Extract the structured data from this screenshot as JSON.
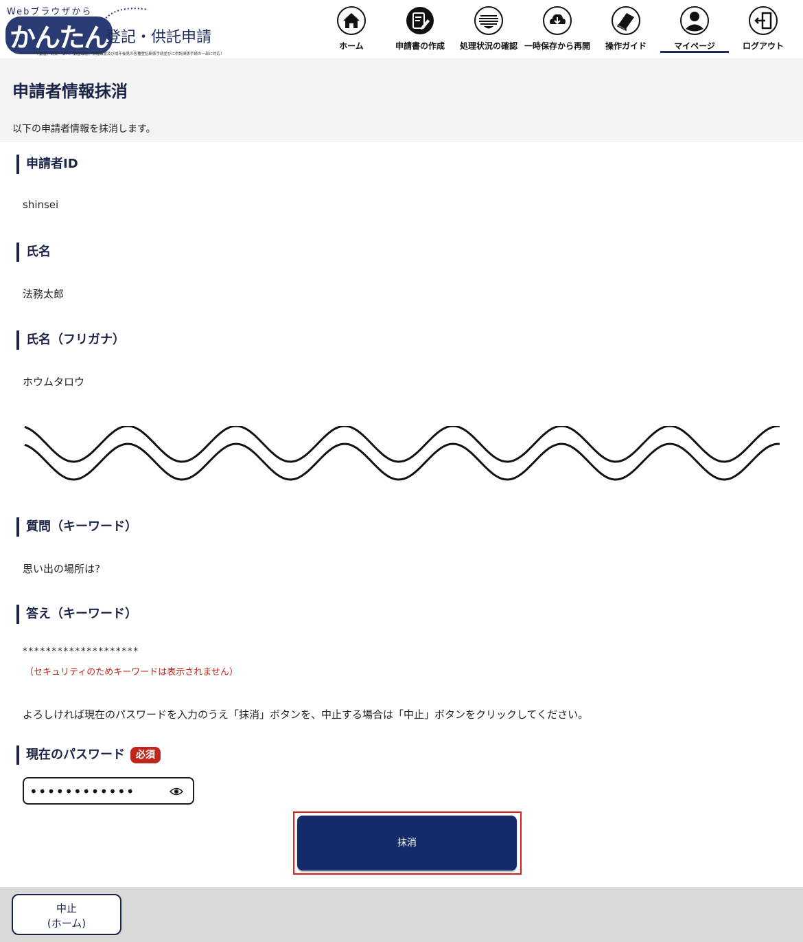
{
  "header": {
    "logo_top": "Webブラウザから",
    "logo_main": "かんたん",
    "logo_sub": "登記・供託申請",
    "logo_note": "「不動産、商業・法人、動産譲渡、債権譲渡及び成年後見の各種登記関係手続並びに供託関係手続の一部に対応！"
  },
  "nav": {
    "items": [
      {
        "label": "ホーム",
        "icon": "home-icon"
      },
      {
        "label": "申請書の作成",
        "icon": "edit-document-icon"
      },
      {
        "label": "処理状況の確認",
        "icon": "status-list-icon"
      },
      {
        "label": "一時保存から再開",
        "icon": "cloud-download-icon"
      },
      {
        "label": "操作ガイド",
        "icon": "guide-book-icon"
      },
      {
        "label": "マイページ",
        "icon": "user-icon",
        "active": true
      },
      {
        "label": "ログアウト",
        "icon": "logout-icon"
      }
    ]
  },
  "page": {
    "title": "申請者情報抹消",
    "description": "以下の申請者情報を抹消します。"
  },
  "fields": {
    "applicant_id": {
      "label": "申請者ID",
      "value": "shinsei"
    },
    "name": {
      "label": "氏名",
      "value": "法務太郎"
    },
    "name_kana": {
      "label": "氏名（フリガナ）",
      "value": "ホウムタロウ"
    },
    "question": {
      "label": "質問（キーワード）",
      "value": "思い出の場所は?"
    },
    "answer": {
      "label": "答え（キーワード）",
      "value": "********************",
      "note": "（セキュリティのためキーワードは表示されません）"
    }
  },
  "instruction": "よろしければ現在のパスワードを入力のうえ「抹消」ボタンを、中止する場合は「中止」ボタンをクリックしてください。",
  "password": {
    "label": "現在のパスワード",
    "required_badge": "必須",
    "value": "••••••••••••"
  },
  "buttons": {
    "delete": "抹消",
    "cancel_line1": "中止",
    "cancel_line2": "(ホーム)"
  },
  "colors": {
    "navy": "#152a6b",
    "heading": "#1b2447",
    "required": "#c0261b",
    "highlight_frame": "#e01a1a"
  }
}
